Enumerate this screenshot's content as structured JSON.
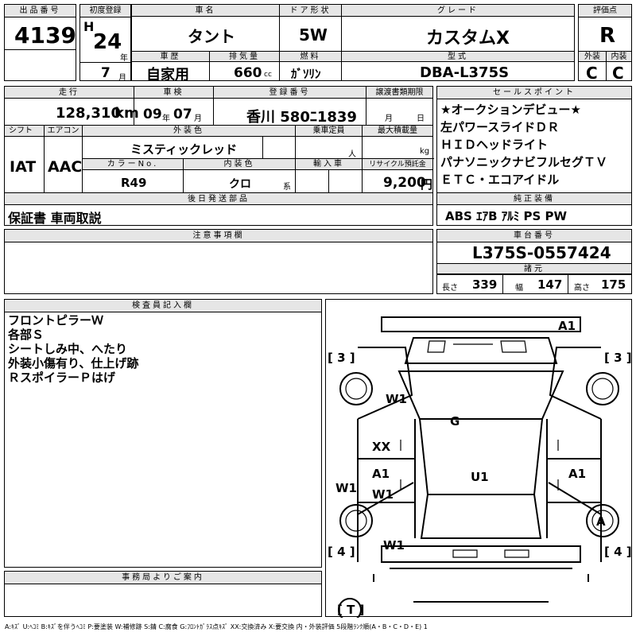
{
  "headers": {
    "lot_no": "出品番号",
    "first_reg": "初度登録",
    "car_name": "車名",
    "door": "ドア形状",
    "grade": "グレード",
    "rating": "評価点",
    "history": "車歴",
    "displacement": "排気量",
    "fuel": "燃料",
    "model": "型式",
    "exterior": "外装",
    "interior": "内装",
    "mileage": "走行",
    "inspection": "車検",
    "reg_no": "登録番号",
    "transfer_docs": "譲渡書類期限",
    "sales_points": "セールスポイント",
    "shift": "シフト",
    "aircon": "エアコン",
    "ext_color": "外装色",
    "capacity": "乗車定員",
    "max_load": "最大積載量",
    "color_no": "カラーNo.",
    "int_color": "内装色",
    "import": "輸入車",
    "recycle": "リサイクル預託金",
    "later_docs": "後日発送部品",
    "std_equipment": "純正装備",
    "notes": "注意事項欄",
    "chassis_no": "車台番号",
    "dimensions": "諸元",
    "inspector": "検査員記入欄",
    "office": "事務局よりご案内"
  },
  "lot_no": "4139",
  "era": "H",
  "year": "24",
  "year_unit": "年",
  "month": "7",
  "month_unit": "月",
  "car_name": "タント",
  "door": "5W",
  "grade": "カスタムX",
  "rating": "R",
  "history": "自家用",
  "displacement": "660",
  "displacement_unit": "cc",
  "fuel": "ｶﾞｿﾘﾝ",
  "model": "DBA-L375S",
  "exterior_grade": "C",
  "interior_grade": "C",
  "mileage": "128,310",
  "mileage_unit": "km",
  "inspection": {
    "year": "09",
    "year_unit": "年",
    "month": "07",
    "month_unit": "月"
  },
  "reg_no": "香川 580ﾆ1839",
  "transfer": {
    "month_unit": "月",
    "day_unit": "日"
  },
  "sales_points": [
    "★オークションデビュー★",
    "左パワースライドＤＲ",
    "ＨＩＤヘッドライト",
    "パナソニックナビフルセグＴＶ",
    "ＥＴＣ・エコアイドル"
  ],
  "shift": "IAT",
  "aircon": "AAC",
  "ext_color": "ミスティックレッド",
  "capacity_unit": "人",
  "load_unit": "kg",
  "color_no": "R49",
  "int_color": "クロ",
  "int_color_unit": "系",
  "recycle": "9,200",
  "recycle_unit": "円",
  "later_docs": "保証書 車両取説",
  "std_equipment": "ABS ｴｱB ｱﾙﾐ PS PW",
  "chassis_no": "L375S-0557424",
  "dims": {
    "length_label": "長さ",
    "length": "339",
    "width_label": "幅",
    "width": "147",
    "height_label": "高さ",
    "height": "175"
  },
  "inspector_notes": [
    "フロントピラーＷ",
    "各部Ｓ",
    "シートしみ中、へたり",
    "外装小傷有り、仕上げ跡",
    "ＲスポイラーＰはげ"
  ],
  "diagram_marks": {
    "front": "A1",
    "w1_upper": "W1",
    "g": "G",
    "xx": "XX",
    "a1_left": "A1",
    "w1_mid": "W1",
    "u1": "U1",
    "a1_right": "A1",
    "w1_left": "W1",
    "a_right": "A",
    "w1_lower": "W1",
    "b3_left": "[ 3 ]",
    "b3_right": "[ 3 ]",
    "b4_left": "[ 4 ]",
    "b4_right": "[ 4 ]",
    "bt": "[ T ]"
  },
  "legend": "A:ｷｽﾞ U:ﾍｺﾐ B:ｷｽﾞを伴うﾍｺﾐ P:要塗装 W:補修跡 S:錆 C:腐食 G:ﾌﾛﾝﾄｶﾞﾗｽ点ｷｽﾞ XX:交換済み X:要交換  内・外装評価 5段階ﾗﾝｸ順(A・B・C・D・E) 1"
}
